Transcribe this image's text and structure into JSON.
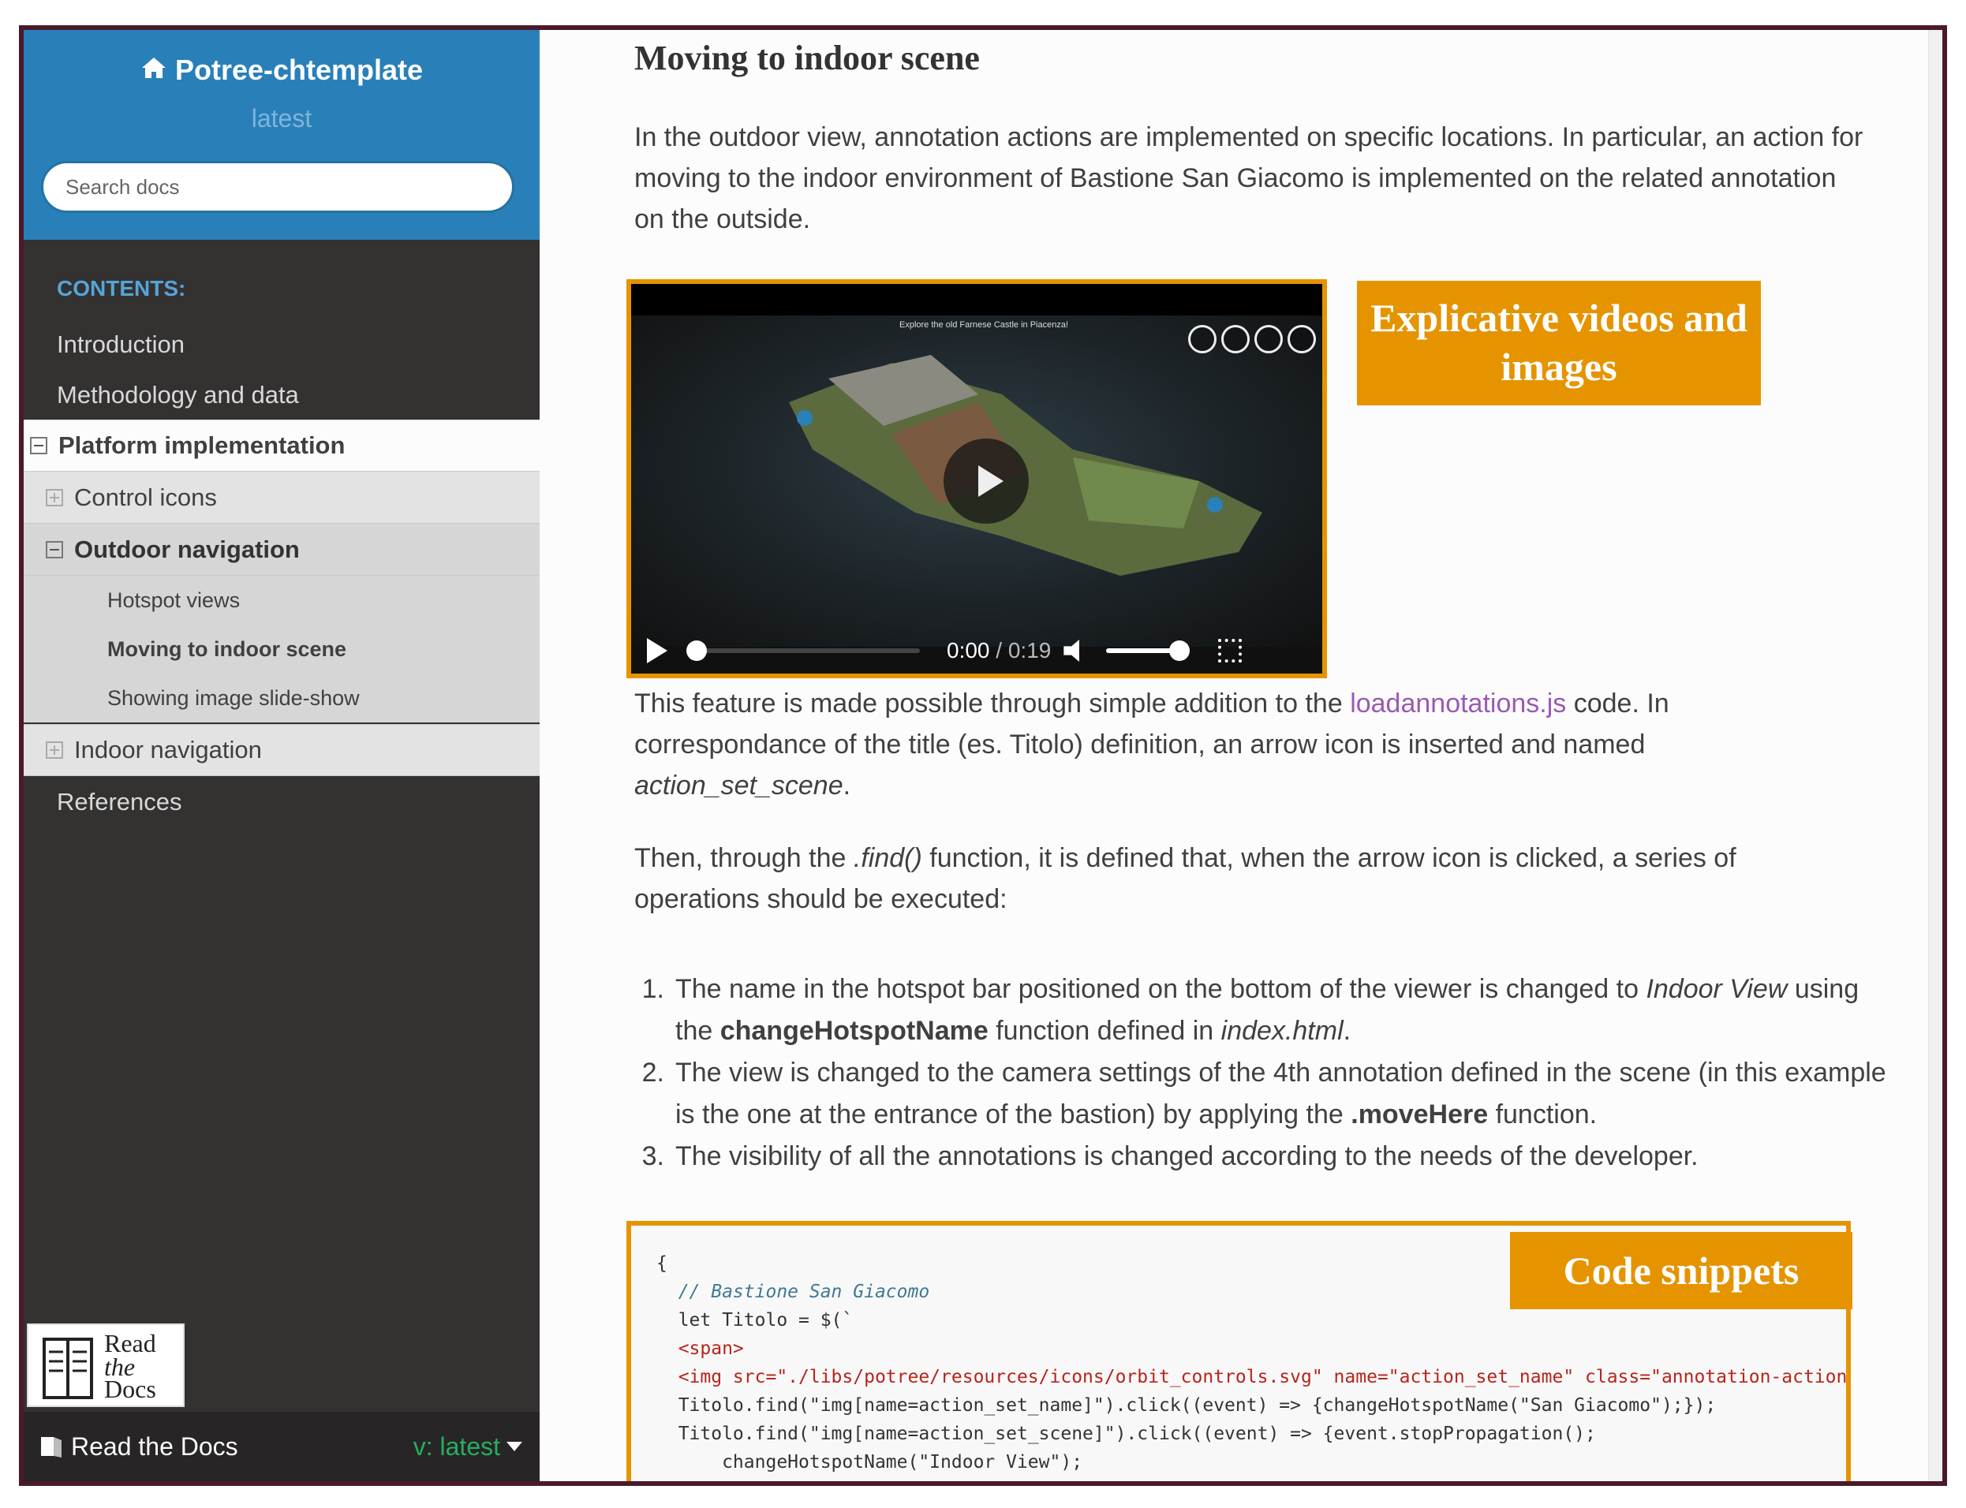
{
  "sidebar": {
    "project_title": "Potree-chtemplate",
    "version": "latest",
    "search_placeholder": "Search docs",
    "caption": "CONTENTS:",
    "items": [
      {
        "label": "Introduction"
      },
      {
        "label": "Methodology and data"
      },
      {
        "label": "Platform implementation"
      },
      {
        "label": "Control icons"
      },
      {
        "label": "Outdoor navigation"
      },
      {
        "label": "Hotspot views"
      },
      {
        "label": "Moving to indoor scene"
      },
      {
        "label": "Showing image slide-show"
      },
      {
        "label": "Indoor navigation"
      },
      {
        "label": "References"
      }
    ],
    "logo_text": [
      "Read",
      "the",
      "Docs"
    ],
    "footer_left": "Read the Docs",
    "footer_right": "v: latest"
  },
  "main": {
    "heading": "Moving to indoor scene",
    "intro": "In the outdoor view, annotation actions are implemented on specific locations. In particular, an action for moving to the indoor environment of Bastione San Giacomo is implemented on the related annotation on the outside.",
    "video": {
      "title": "Explore the old Farnese Castle in Piacenza!",
      "current_time": "0:00",
      "duration": "0:19",
      "progress": 0
    },
    "p2_before": "This feature is made possible through simple addition to the ",
    "p2_link": "loadannotations.js",
    "p2_after": " code. In correspondance of the title (es. Titolo) definition, an arrow icon is inserted and named ",
    "p2_italic": "action_set_scene",
    "p2_end": ".",
    "p3_before": "Then, through the ",
    "p3_italic": ".find()",
    "p3_after": " function, it is defined that, when the arrow icon is clicked, a series of operations should be executed:",
    "steps": [
      {
        "num": "1.",
        "a": "The name in the hotspot bar positioned on the bottom of the viewer is changed to ",
        "i1": "Indoor View",
        "b": " using the ",
        "bold": "changeHotspotName",
        "c": " function defined in ",
        "i2": "index.html",
        "d": "."
      },
      {
        "num": "2.",
        "a": "The view is changed to the camera settings of the 4th annotation defined in the scene (in this example is the one at the entrance of the bastion) by applying the ",
        "bold": ".moveHere",
        "b": " function."
      },
      {
        "num": "3.",
        "a": "The visibility of all the annotations is changed according to the needs of the developer."
      }
    ],
    "code_lines": [
      "{",
      "  // Bastione San Giacomo",
      "  let Titolo = $(`",
      "  <span>",
      "  <img src=\"./libs/potree/resources/icons/orbit_controls.svg\" name=\"action_set_name\" class=\"annotation-action",
      "  Titolo.find(\"img[name=action_set_name]\").click((event) => {changeHotspotName(\"San Giacomo\");});",
      "  Titolo.find(\"img[name=action_set_scene]\").click((event) => {event.stopPropagation();",
      "      changeHotspotName(\"Indoor View\");"
    ]
  },
  "annotations": {
    "video_label": "Explicative videos and images",
    "code_label": "Code snippets"
  },
  "colors": {
    "sidebar_bg": "#343131",
    "header_blue": "#2980b9",
    "accent_orange": "#e59400",
    "link_purple": "#9b59b6",
    "version_green": "#27ae60",
    "frame": "#4a1a2c"
  }
}
